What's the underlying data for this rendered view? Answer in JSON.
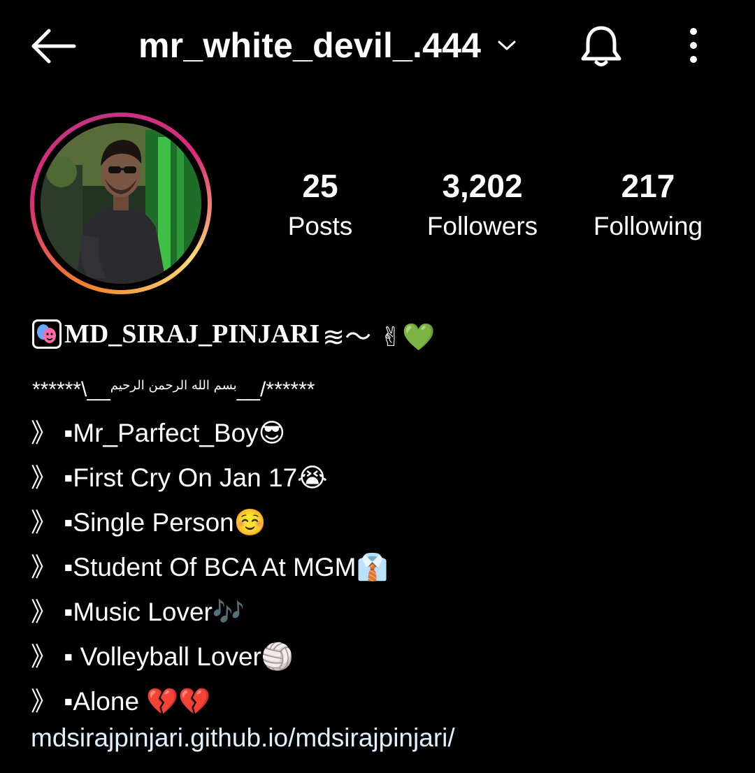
{
  "header": {
    "username": "mr_white_devil_.444"
  },
  "stats": {
    "posts": {
      "value": "25",
      "label": "Posts"
    },
    "followers": {
      "value": "3,202",
      "label": "Followers"
    },
    "following": {
      "value": "217",
      "label": "Following"
    }
  },
  "profile": {
    "display_name": "MD_SIRAJ_PINJARI",
    "display_name_suffix": "≋〜 ✌💚",
    "bio_stars_left": "******\\__",
    "bio_arabic": "بسم الله الرحمن الرحيم",
    "bio_stars_right": "__/******",
    "bio_lines": [
      "》 ▪Mr_Parfect_Boy😎",
      "》 ▪First Cry On Jan 17😭",
      "》 ▪Single Person☺️",
      "》 ▪Student Of BCA At MGM👔",
      "》 ▪Music Lover🎶",
      "》 ▪ Volleyball Lover🏐",
      "》 ▪Alone 💔💔"
    ],
    "link": "mdsirajpinjari.github.io/mdsirajpinjari/"
  },
  "colors": {
    "background": "#000000",
    "text": "#ffffff",
    "link": "#e0f1ff",
    "story_ring_start": "#f58529",
    "story_ring_end": "#dd2a7b"
  },
  "icons": [
    "back-arrow-icon",
    "chevron-down-icon",
    "bell-icon",
    "more-vertical-icon"
  ]
}
